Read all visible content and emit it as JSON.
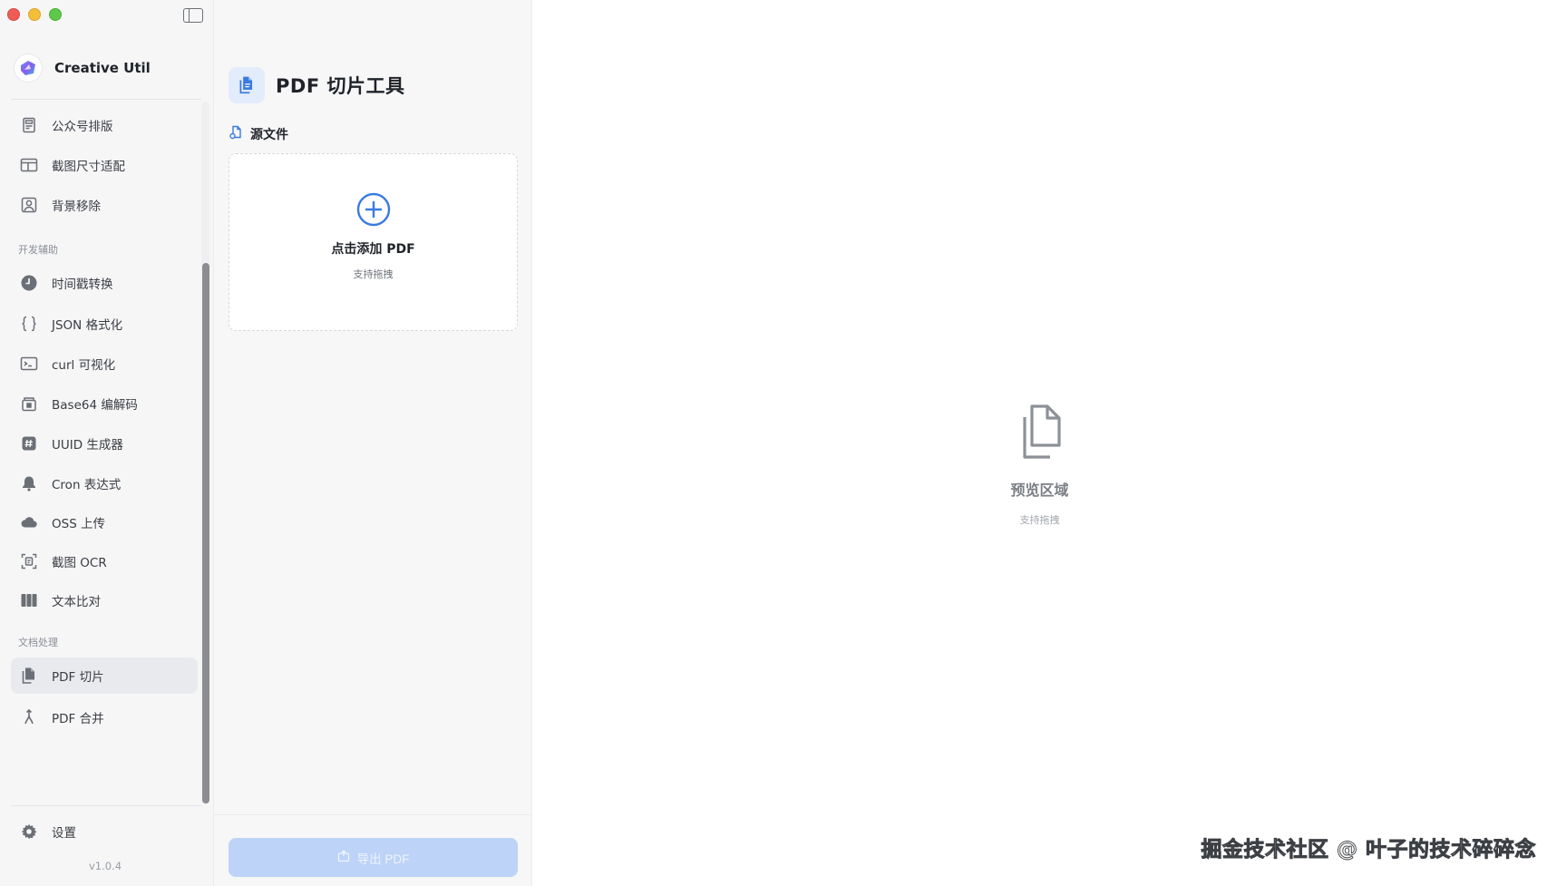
{
  "app": {
    "name": "Creative Util",
    "version": "v1.0.4"
  },
  "sidebar": {
    "items_top": [
      {
        "label": "公众号排版",
        "icon": "article-layout-icon"
      },
      {
        "label": "截图尺寸适配",
        "icon": "screenshot-resize-icon"
      },
      {
        "label": "背景移除",
        "icon": "background-remove-icon"
      }
    ],
    "section_dev": "开发辅助",
    "items_dev": [
      {
        "label": "时间戳转换",
        "icon": "clock-icon"
      },
      {
        "label": "JSON 格式化",
        "icon": "braces-icon"
      },
      {
        "label": "curl 可视化",
        "icon": "terminal-icon"
      },
      {
        "label": "Base64 编解码",
        "icon": "lock-icon"
      },
      {
        "label": "UUID 生成器",
        "icon": "hash-icon"
      },
      {
        "label": "Cron 表达式",
        "icon": "bell-icon"
      },
      {
        "label": "OSS 上传",
        "icon": "cloud-icon"
      },
      {
        "label": "截图 OCR",
        "icon": "ocr-scan-icon"
      },
      {
        "label": "文本比对",
        "icon": "columns-icon"
      }
    ],
    "section_doc": "文档处理",
    "items_doc": [
      {
        "label": "PDF 切片",
        "icon": "documents-icon"
      },
      {
        "label": "PDF 合并",
        "icon": "merge-icon"
      }
    ],
    "settings_label": "设置"
  },
  "panel": {
    "title": "PDF 切片工具",
    "source_label": "源文件",
    "dropzone_title": "点击添加 PDF",
    "dropzone_hint": "支持拖拽",
    "export_label": "导出 PDF"
  },
  "preview": {
    "title": "预览区域",
    "hint": "支持拖拽"
  },
  "watermark": "掘金技术社区 @ 叶子的技术碎碎念",
  "colors": {
    "accent": "#3a7be0",
    "export_disabled": "#bdd3f7",
    "panel_icon_bg": "#e3ecfb"
  }
}
